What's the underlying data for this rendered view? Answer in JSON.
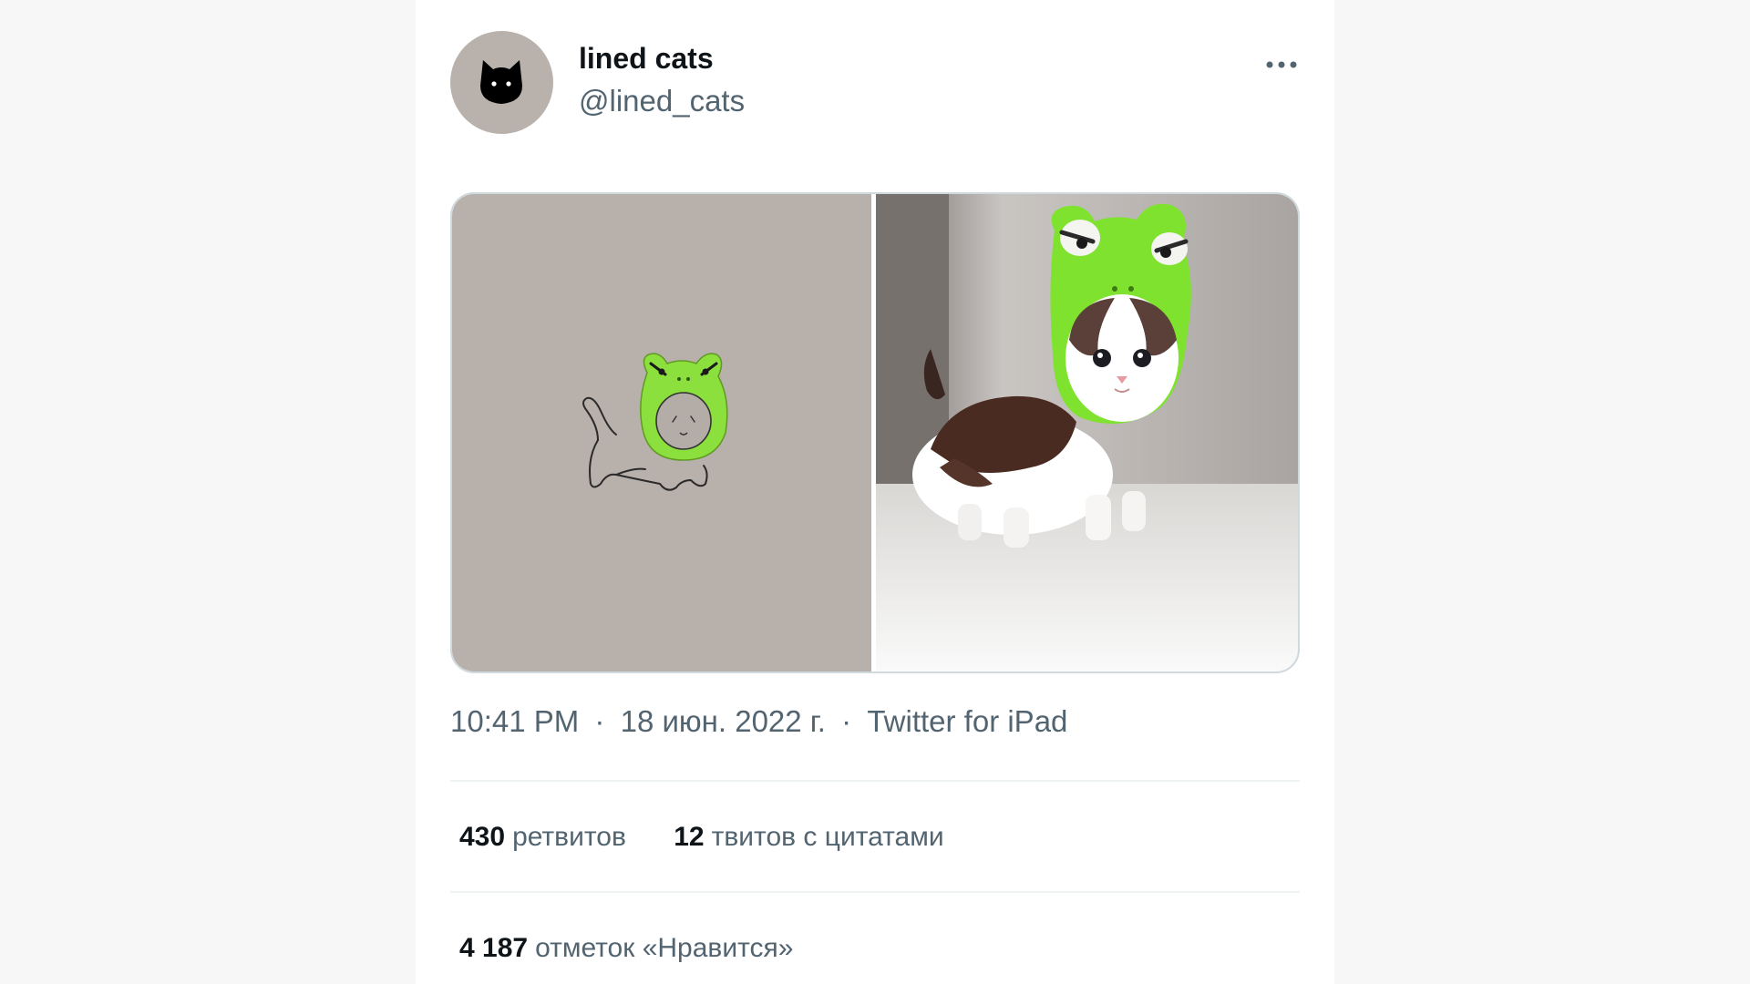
{
  "tweet": {
    "author": {
      "display_name": "lined cats",
      "handle": "@lined_cats",
      "avatar_icon": "black-cat-icon"
    },
    "more_icon": "more-horizontal-icon",
    "media": [
      {
        "icon": "cat-frog-hat-drawing"
      },
      {
        "icon": "kitten-frog-hat-photo"
      }
    ],
    "meta": {
      "time": "10:41 PM",
      "separator": "·",
      "date": "18 июн. 2022 г.",
      "source": "Twitter for iPad"
    },
    "stats": {
      "retweets_count": "430",
      "retweets_label": "ретвитов",
      "quotes_count": "12",
      "quotes_label": "твитов с цитатами",
      "likes_count": "4 187",
      "likes_label": "отметок «Нравится»"
    }
  },
  "colors": {
    "background": "#f7f7f7",
    "card": "#ffffff",
    "primary_text": "#0f1419",
    "secondary_text": "#536471",
    "frog_green": "#86e33a",
    "avatar_bg": "#b9b2ac"
  }
}
